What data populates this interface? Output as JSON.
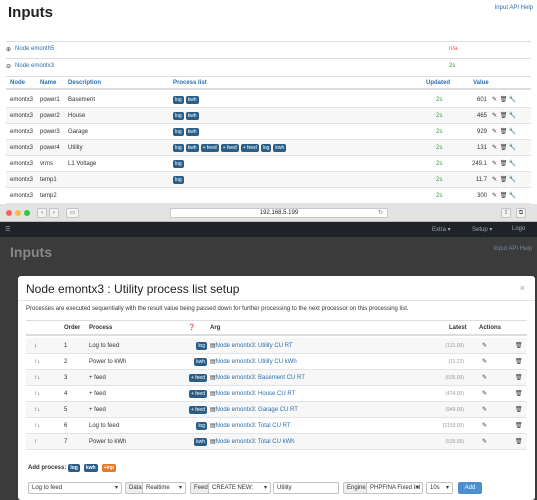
{
  "page": {
    "title": "Inputs",
    "help_link": "Input API Help",
    "nodes": [
      {
        "label": "Node emonth5",
        "status": "n/a"
      },
      {
        "label": "Node emontx3",
        "status": "2s"
      }
    ],
    "columns": {
      "node": "Node",
      "name": "Name",
      "description": "Description",
      "process": "Process list",
      "updated": "Updated",
      "value": "Value"
    },
    "rows": [
      {
        "node": "emontx3",
        "name": "power1",
        "description": "Basement",
        "tags": [
          "log",
          "kwh"
        ],
        "updated": "2s",
        "value": "601"
      },
      {
        "node": "emontx3",
        "name": "power2",
        "description": "House",
        "tags": [
          "log",
          "kwh"
        ],
        "updated": "2s",
        "value": "465"
      },
      {
        "node": "emontx3",
        "name": "power3",
        "description": "Garage",
        "tags": [
          "log",
          "kwh"
        ],
        "updated": "2s",
        "value": "929"
      },
      {
        "node": "emontx3",
        "name": "power4",
        "description": "Utility",
        "tags": [
          "log",
          "kwh",
          "+ feed",
          "+ feed",
          "+ feed",
          "log",
          "kwh"
        ],
        "updated": "2s",
        "value": "131"
      },
      {
        "node": "emontx3",
        "name": "vrms",
        "description": "L1 Voltage",
        "tags": [
          "log"
        ],
        "updated": "2s",
        "value": "249.1"
      },
      {
        "node": "emontx3",
        "name": "temp1",
        "description": "",
        "tags": [
          "log"
        ],
        "updated": "2s",
        "value": "11.7"
      },
      {
        "node": "emontx3",
        "name": "temp2",
        "description": "",
        "tags": [],
        "updated": "2s",
        "value": "300"
      }
    ]
  },
  "browser": {
    "url": "192.168.5.199",
    "colors": {
      "close": "#fc605b",
      "min": "#fdbc40",
      "max": "#34c84a"
    }
  },
  "background": {
    "title": "Inputs",
    "help": "Input API Help",
    "nav": [
      "Extra ▾",
      "Setup ▾",
      "Logo"
    ]
  },
  "modal": {
    "title": "Node emontx3 : Utility process list setup",
    "close": "×",
    "description": "Processes are executed sequentially with the result value being passed down for further processing to the next processor on this processing list.",
    "columns": {
      "order": "Order",
      "process": "Process",
      "arg": "Arg",
      "latest": "Latest",
      "actions": "Actions"
    },
    "processes": [
      {
        "arrows": "↓",
        "order": "1",
        "process": "Log to feed",
        "tag": "log",
        "arg": "Node emontx3: Utility CU RT",
        "latest": "(131.00)"
      },
      {
        "arrows": "↑↓",
        "order": "2",
        "process": "Power to kWh",
        "tag": "kwh",
        "arg": "Node emontx3: Utility CU kWh",
        "latest": "(11.22)"
      },
      {
        "arrows": "↑↓",
        "order": "3",
        "process": "+ feed",
        "tag": "+ feed",
        "arg": "Node emontx3: Basement CU RT",
        "latest": "(605.00)"
      },
      {
        "arrows": "↑↓",
        "order": "4",
        "process": "+ feed",
        "tag": "+ feed",
        "arg": "Node emontx3: House CU RT",
        "latest": "(474.00)"
      },
      {
        "arrows": "↑↓",
        "order": "5",
        "process": "+ feed",
        "tag": "+ feed",
        "arg": "Node emontx3: Garage CU RT",
        "latest": "(949.00)"
      },
      {
        "arrows": "↑↓",
        "order": "6",
        "process": "Log to feed",
        "tag": "log",
        "arg": "Node emontx3: Total CU RT",
        "latest": "(2159.00)"
      },
      {
        "arrows": "↑",
        "order": "7",
        "process": "Power to kWh",
        "tag": "kwh",
        "arg": "Node emontx3: Total CU kWh",
        "latest": "(539.95)"
      }
    ],
    "add_process": {
      "label": "Add process:",
      "tags": [
        "log",
        "kwh",
        "+inp"
      ]
    },
    "form": {
      "process_select": "Log to feed",
      "data_label": "Data",
      "data_select": "Realtime",
      "feed_label": "Feed",
      "feed_select": "CREATE NEW:",
      "feed_name": "Utility",
      "engine_label": "Engine",
      "engine_select": "PHPFINA Fixed Int",
      "interval_select": "10s",
      "add_button": "Add"
    }
  }
}
